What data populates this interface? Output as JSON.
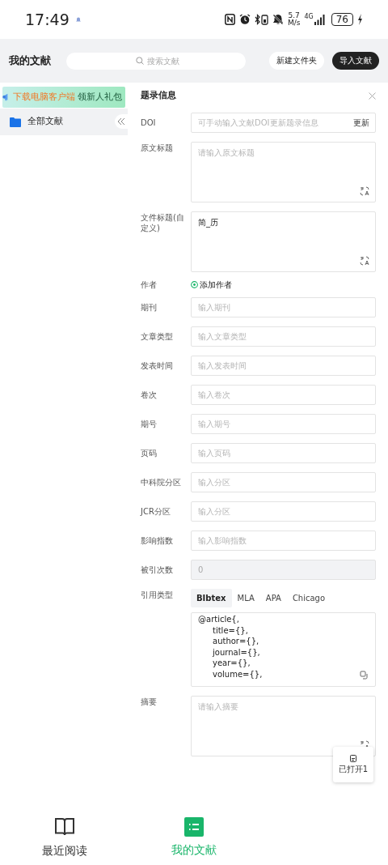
{
  "status_bar": {
    "time": "17:49",
    "net_speed_value": "5.7",
    "net_speed_unit": "M/s",
    "network": "4G",
    "battery": "76"
  },
  "header": {
    "title": "我的文献",
    "search_placeholder": "搜索文献",
    "buttons": [
      {
        "label": "新建文件夹",
        "kind": "secondary"
      },
      {
        "label": "导入文献",
        "kind": "primary"
      }
    ]
  },
  "sidebar": {
    "banner": {
      "highlight": "下载电脑客户端",
      "text": "领新人礼包"
    },
    "items": [
      {
        "label": "全部文献",
        "selected": true
      }
    ]
  },
  "panel": {
    "title": "题录信息",
    "fields": [
      {
        "kind": "input",
        "label": "DOI",
        "placeholder": "可手动输入文献DOI更新题录信息",
        "action": "更新"
      },
      {
        "kind": "textarea",
        "label": "原文标题",
        "placeholder": "请输入原文标题"
      },
      {
        "kind": "textarea",
        "label": "文件标题(自定义)",
        "value": "简_历"
      },
      {
        "kind": "authors",
        "label": "作者",
        "action": "添加作者"
      },
      {
        "kind": "input",
        "label": "期刊",
        "placeholder": "输入期刊"
      },
      {
        "kind": "input",
        "label": "文章类型",
        "placeholder": "输入文章类型"
      },
      {
        "kind": "input",
        "label": "发表时间",
        "placeholder": "输入发表时间"
      },
      {
        "kind": "input",
        "label": "卷次",
        "placeholder": "输入卷次"
      },
      {
        "kind": "input",
        "label": "期号",
        "placeholder": "输入期号"
      },
      {
        "kind": "input",
        "label": "页码",
        "placeholder": "输入页码"
      },
      {
        "kind": "input",
        "label": "中科院分区",
        "placeholder": "输入分区"
      },
      {
        "kind": "input",
        "label": "JCR分区",
        "placeholder": "输入分区"
      },
      {
        "kind": "input",
        "label": "影响指数",
        "placeholder": "输入影响指数"
      },
      {
        "kind": "readonly",
        "label": "被引次数",
        "value": "0"
      },
      {
        "kind": "citation",
        "label": "引用类型",
        "tabs": [
          {
            "label": "BIbtex",
            "selected": true
          },
          {
            "label": "MLA",
            "selected": false
          },
          {
            "label": "APA",
            "selected": false
          },
          {
            "label": "Chicago",
            "selected": false
          }
        ],
        "code_head": "@article{,",
        "code_entries": [
          "title={},",
          "author={},",
          "journal={},",
          "year={},",
          "volume={},"
        ]
      },
      {
        "kind": "textarea",
        "label": "摘要",
        "placeholder": "请输入摘要"
      }
    ]
  },
  "floating_button": {
    "label": "已打开1"
  },
  "bottom_nav": [
    {
      "label": "最近阅读",
      "selected": false
    },
    {
      "label": "我的文献",
      "selected": true
    }
  ]
}
